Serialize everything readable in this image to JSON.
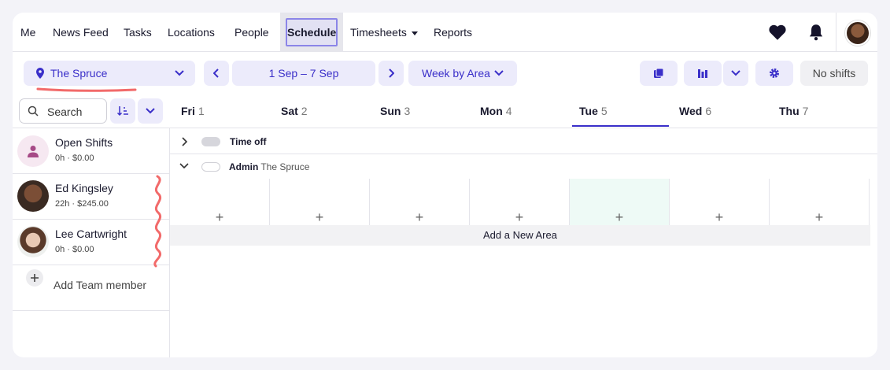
{
  "nav": {
    "items": [
      "Me",
      "News Feed",
      "Tasks",
      "Locations",
      "People"
    ],
    "schedule": "Schedule",
    "timesheets": "Timesheets",
    "reports": "Reports"
  },
  "toolbar": {
    "location": "The Spruce",
    "date_range": "1 Sep – 7 Sep",
    "view": "Week by Area",
    "no_shifts": "No shifts"
  },
  "search": {
    "placeholder": "Search"
  },
  "days": [
    {
      "name": "Fri",
      "num": "1"
    },
    {
      "name": "Sat",
      "num": "2"
    },
    {
      "name": "Sun",
      "num": "3"
    },
    {
      "name": "Mon",
      "num": "4"
    },
    {
      "name": "Tue",
      "num": "5"
    },
    {
      "name": "Wed",
      "num": "6"
    },
    {
      "name": "Thu",
      "num": "7"
    }
  ],
  "people": [
    {
      "name": "Open Shifts",
      "sub": "0h · $0.00"
    },
    {
      "name": "Ed Kingsley",
      "sub": "22h · $245.00"
    },
    {
      "name": "Lee Cartwright",
      "sub": "0h · $0.00"
    }
  ],
  "add_team_member": "Add Team member",
  "grid": {
    "time_off": "Time off",
    "area_name": "Admin",
    "area_location": "The Spruce",
    "add_area": "Add a New Area",
    "plus": "+"
  },
  "colors": {
    "accent": "#3a2fc9",
    "pill_bg": "#ecebfb",
    "annotation": "#f26a6a",
    "today_bg": "#eefaf6"
  }
}
